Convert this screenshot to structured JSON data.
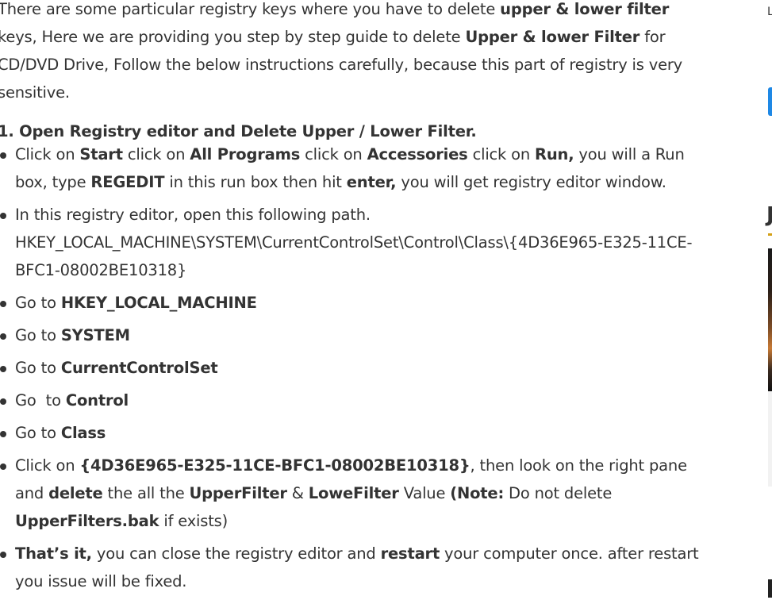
{
  "intro": {
    "t1": "There are some particular registry keys where you have to delete ",
    "b1": "upper & lower filter",
    "t2": " keys, Here we are  providing you step by step guide to delete ",
    "b2": "Upper & lower Filter",
    "t3": " for CD/DVD Drive, Follow the below instructions carefully, because this part of registry is very sensitive."
  },
  "heading": "1. Open Registry editor and Delete Upper / Lower Filter.",
  "steps": {
    "s1": {
      "t1": "Click on ",
      "b1": "Start",
      "t2": " click on ",
      "b2": "All Programs",
      "t3": " click on ",
      "b3": "Accessories",
      "t4": " click on ",
      "b4": "Run,",
      "t5": " you will a Run box, type ",
      "b5": "REGEDIT",
      "t6": " in this run box then hit ",
      "b6": "enter,",
      "t7": " you will get registry editor window."
    },
    "s2": {
      "t1": "In this registry editor, open this following path.",
      "path": "HKEY_LOCAL_MACHINE\\SYSTEM\\CurrentControlSet\\Control\\Class\\{4D36E965-E325-11CE-BFC1-08002BE10318}"
    },
    "s3": {
      "t1": "Go to ",
      "b1": "HKEY_LOCAL_MACHINE"
    },
    "s4": {
      "t1": "Go to ",
      "b1": "SYSTEM"
    },
    "s5": {
      "t1": "Go to ",
      "b1": "CurrentControlSet"
    },
    "s6": {
      "t1": "Go  to ",
      "b1": "Control"
    },
    "s7": {
      "t1": "Go to ",
      "b1": "Class"
    },
    "s8": {
      "t1": "Click on ",
      "b1": "{4D36E965-E325-11CE-BFC1-08002BE10318}",
      "t2": ", then look on the right pane and ",
      "b2": "delete",
      "t3": " the all the ",
      "b3": "UpperFilter",
      "t4": " & ",
      "b4": "LoweFilter",
      "t5": " Value ",
      "b5": "(Note:",
      "t6": " Do not delete ",
      "b6": "UpperFilters.bak",
      "t7": " if exists)"
    },
    "s9": {
      "b1": "That’s it,",
      "t1": " you can close the registry editor and ",
      "b2": "restart",
      "t2": " your computer once. after restart you issue will be fixed."
    }
  },
  "sidebar": {
    "letter": "L",
    "heading_letter": "J"
  }
}
